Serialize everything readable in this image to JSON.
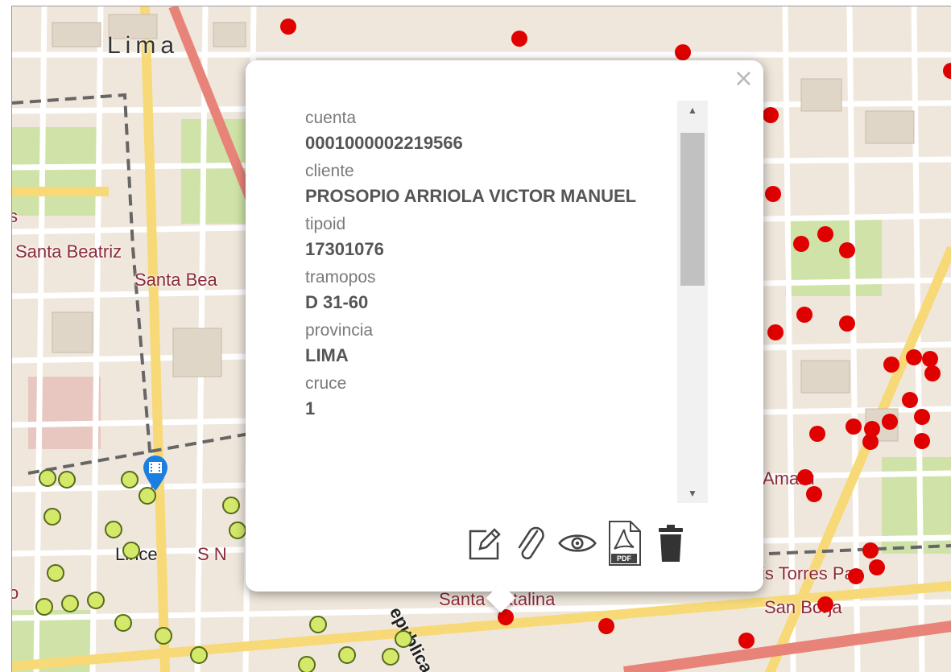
{
  "map": {
    "labels": {
      "city": "Lima",
      "santa_beatriz": "Santa Beatriz",
      "santa_bea": "Santa Bea",
      "lince": "Lince",
      "sn": "S N",
      "santa_catalina": "Santa Catalina",
      "amaru": "Amaru",
      "luis_torres": "is Torres Paz",
      "san_borja": "San Borja",
      "republica": "epublica",
      "s_left": "s",
      "o_left": "o"
    },
    "colors": {
      "red_dot": "#e00000",
      "green_dot": "#d4e86a",
      "marker": "#1a7fe0"
    }
  },
  "popup": {
    "close_label": "×",
    "fields": [
      {
        "label": "cuenta",
        "value": "0001000002219566"
      },
      {
        "label": "cliente",
        "value": "PROSOPIO ARRIOLA VICTOR MANUEL"
      },
      {
        "label": "tipoid",
        "value": "17301076"
      },
      {
        "label": "tramopos",
        "value": "D 31-60"
      },
      {
        "label": "provincia",
        "value": "LIMA"
      },
      {
        "label": "cruce",
        "value": "1"
      }
    ],
    "scroll_up": "▲",
    "scroll_down": "▼",
    "actions": {
      "edit": "edit-icon",
      "attach": "paperclip-icon",
      "view": "eye-icon",
      "pdf": "pdf-icon",
      "pdf_text": "PDF",
      "delete": "trash-icon"
    }
  }
}
